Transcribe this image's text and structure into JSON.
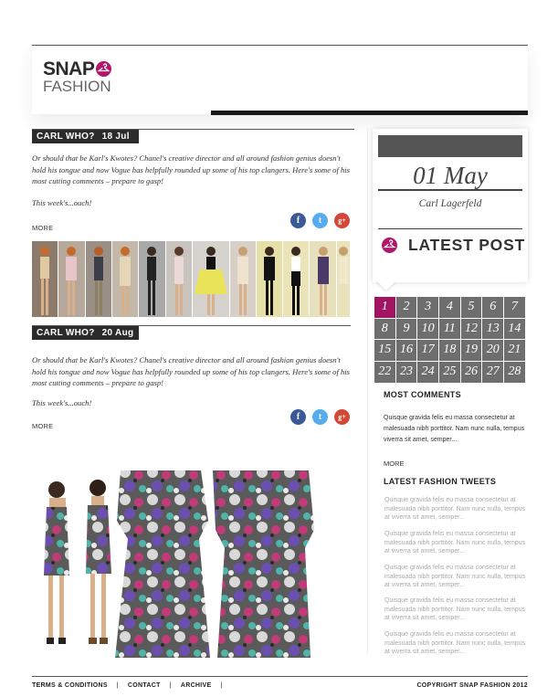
{
  "brand": {
    "line1": "SNAP",
    "line2": "FASHION",
    "accent": "#b1176c"
  },
  "posts": [
    {
      "label": "CARL WHO?",
      "date": "18 Jul",
      "excerpt": "Or should that be Karl's Kwotes? Chanel's creative director and all around fashion genius doesn't hold his tongue and now Vogue has helpfully rounded up some of his top clangers. Here's some of his most cutting comments – prepare to gasp!",
      "subline": "This week's...ouch!",
      "more": "MORE"
    },
    {
      "label": "CARL WHO?",
      "date": "20 Aug",
      "excerpt": "Or should that be Karl's Kwotes? Chanel's creative director and all around fashion genius doesn't hold his tongue and now Vogue has helpfully rounded up some of his top clangers. Here's some of his most cutting comments – prepare to gasp!",
      "subline": "This week's...ouch!",
      "more": "MORE"
    }
  ],
  "social": {
    "facebook": "f",
    "twitter": "t",
    "googleplus": "g+"
  },
  "sidebar": {
    "date": "01  May",
    "author": "Carl Lagerfeld",
    "latest_post": "LATEST POST",
    "calendar_days": [
      "1",
      "2",
      "3",
      "4",
      "5",
      "6",
      "7",
      "8",
      "9",
      "10",
      "11",
      "12",
      "13",
      "14",
      "15",
      "16",
      "17",
      "18",
      "19",
      "20",
      "21",
      "22",
      "23",
      "24",
      "25",
      "26",
      "27",
      "28"
    ],
    "active_day": "1",
    "most_comments": {
      "heading": "MOST COMMENTS",
      "text": "Quisque gravida felis eu massa consectetur at malesuada nibh porttitor. Nam nunc nulla, tempus viverra sit amet, semper...",
      "more": "MORE"
    },
    "tweets_heading": "LATEST FASHION TWEETS",
    "tweets": [
      "Quisque gravida felis eu massa consectetur at malesuada nibh porttitor. Nam nunc nulla, tempus at viverra sit amet, semper...",
      "Quisque gravida felis eu massa consectetur at malesuada nibh porttitor. Nam nunc nulla, tempus at viverra sit amet, semper...",
      "Quisque gravida felis eu massa consectetur at malesuada nibh porttitor. Nam nunc nulla, tempus at viverra sit amet, semper...",
      "Quisque gravida felis eu massa consectetur at malesuada nibh porttitor. Nam nunc nulla, tempus at viverra sit amet, semper...",
      "Quisque gravida felis eu massa consectetur at malesuada nibh porttitor. Nam nunc nulla, tempus at viverra sit amet, semper..."
    ]
  },
  "footer": {
    "links": [
      "TERMS & CONDITIONS",
      "CONTACT",
      "ARCHIVE"
    ],
    "separator": "|",
    "copyright": "COPYRIGHT SNAP FASHION 2012"
  }
}
